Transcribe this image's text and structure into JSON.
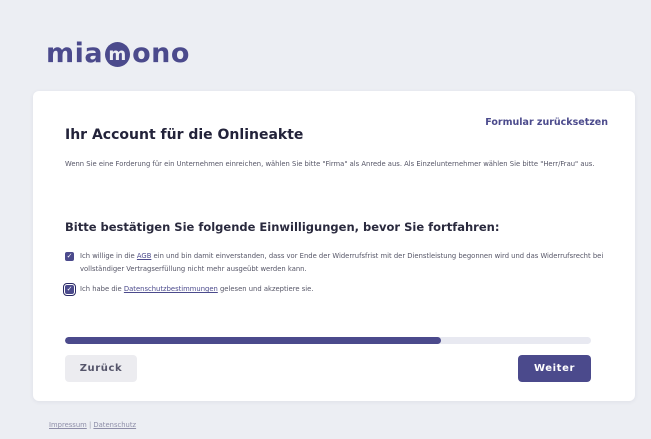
{
  "brand": {
    "logo_prefix": "mia",
    "logo_mark": "m",
    "logo_suffix": "ono",
    "accent_color": "#4b4a8c"
  },
  "card": {
    "reset_label": "Formular zurücksetzen",
    "title": "Ihr Account für die Onlineakte",
    "intro": "Wenn Sie eine Forderung für ein Unternehmen einreichen, wählen Sie bitte \"Firma\" als Anrede aus. Als Einzelunternehmer wählen Sie bitte \"Herr/Frau\" aus.",
    "consent_heading": "Bitte bestätigen Sie folgende Einwilligungen, bevor Sie fortfahren:",
    "consents": [
      {
        "checked": true,
        "text_before": "Ich willige in die ",
        "link": "AGB",
        "text_after": " ein und bin damit einverstanden, dass vor Ende der Widerrufsfrist mit der Dienstleistung begonnen wird und das Widerrufsrecht bei vollständiger Vertragserfüllung nicht mehr ausgeübt werden kann."
      },
      {
        "checked": true,
        "text_before": "Ich habe die ",
        "link": "Datenschutzbestimmungen",
        "text_after": " gelesen und akzeptiere sie."
      }
    ],
    "progress_fraction": 0.715,
    "back_label": "Zurück",
    "next_label": "Weiter"
  },
  "footer": {
    "impressum": "Impressum",
    "separator": " | ",
    "datenschutz": "Datenschutz"
  }
}
